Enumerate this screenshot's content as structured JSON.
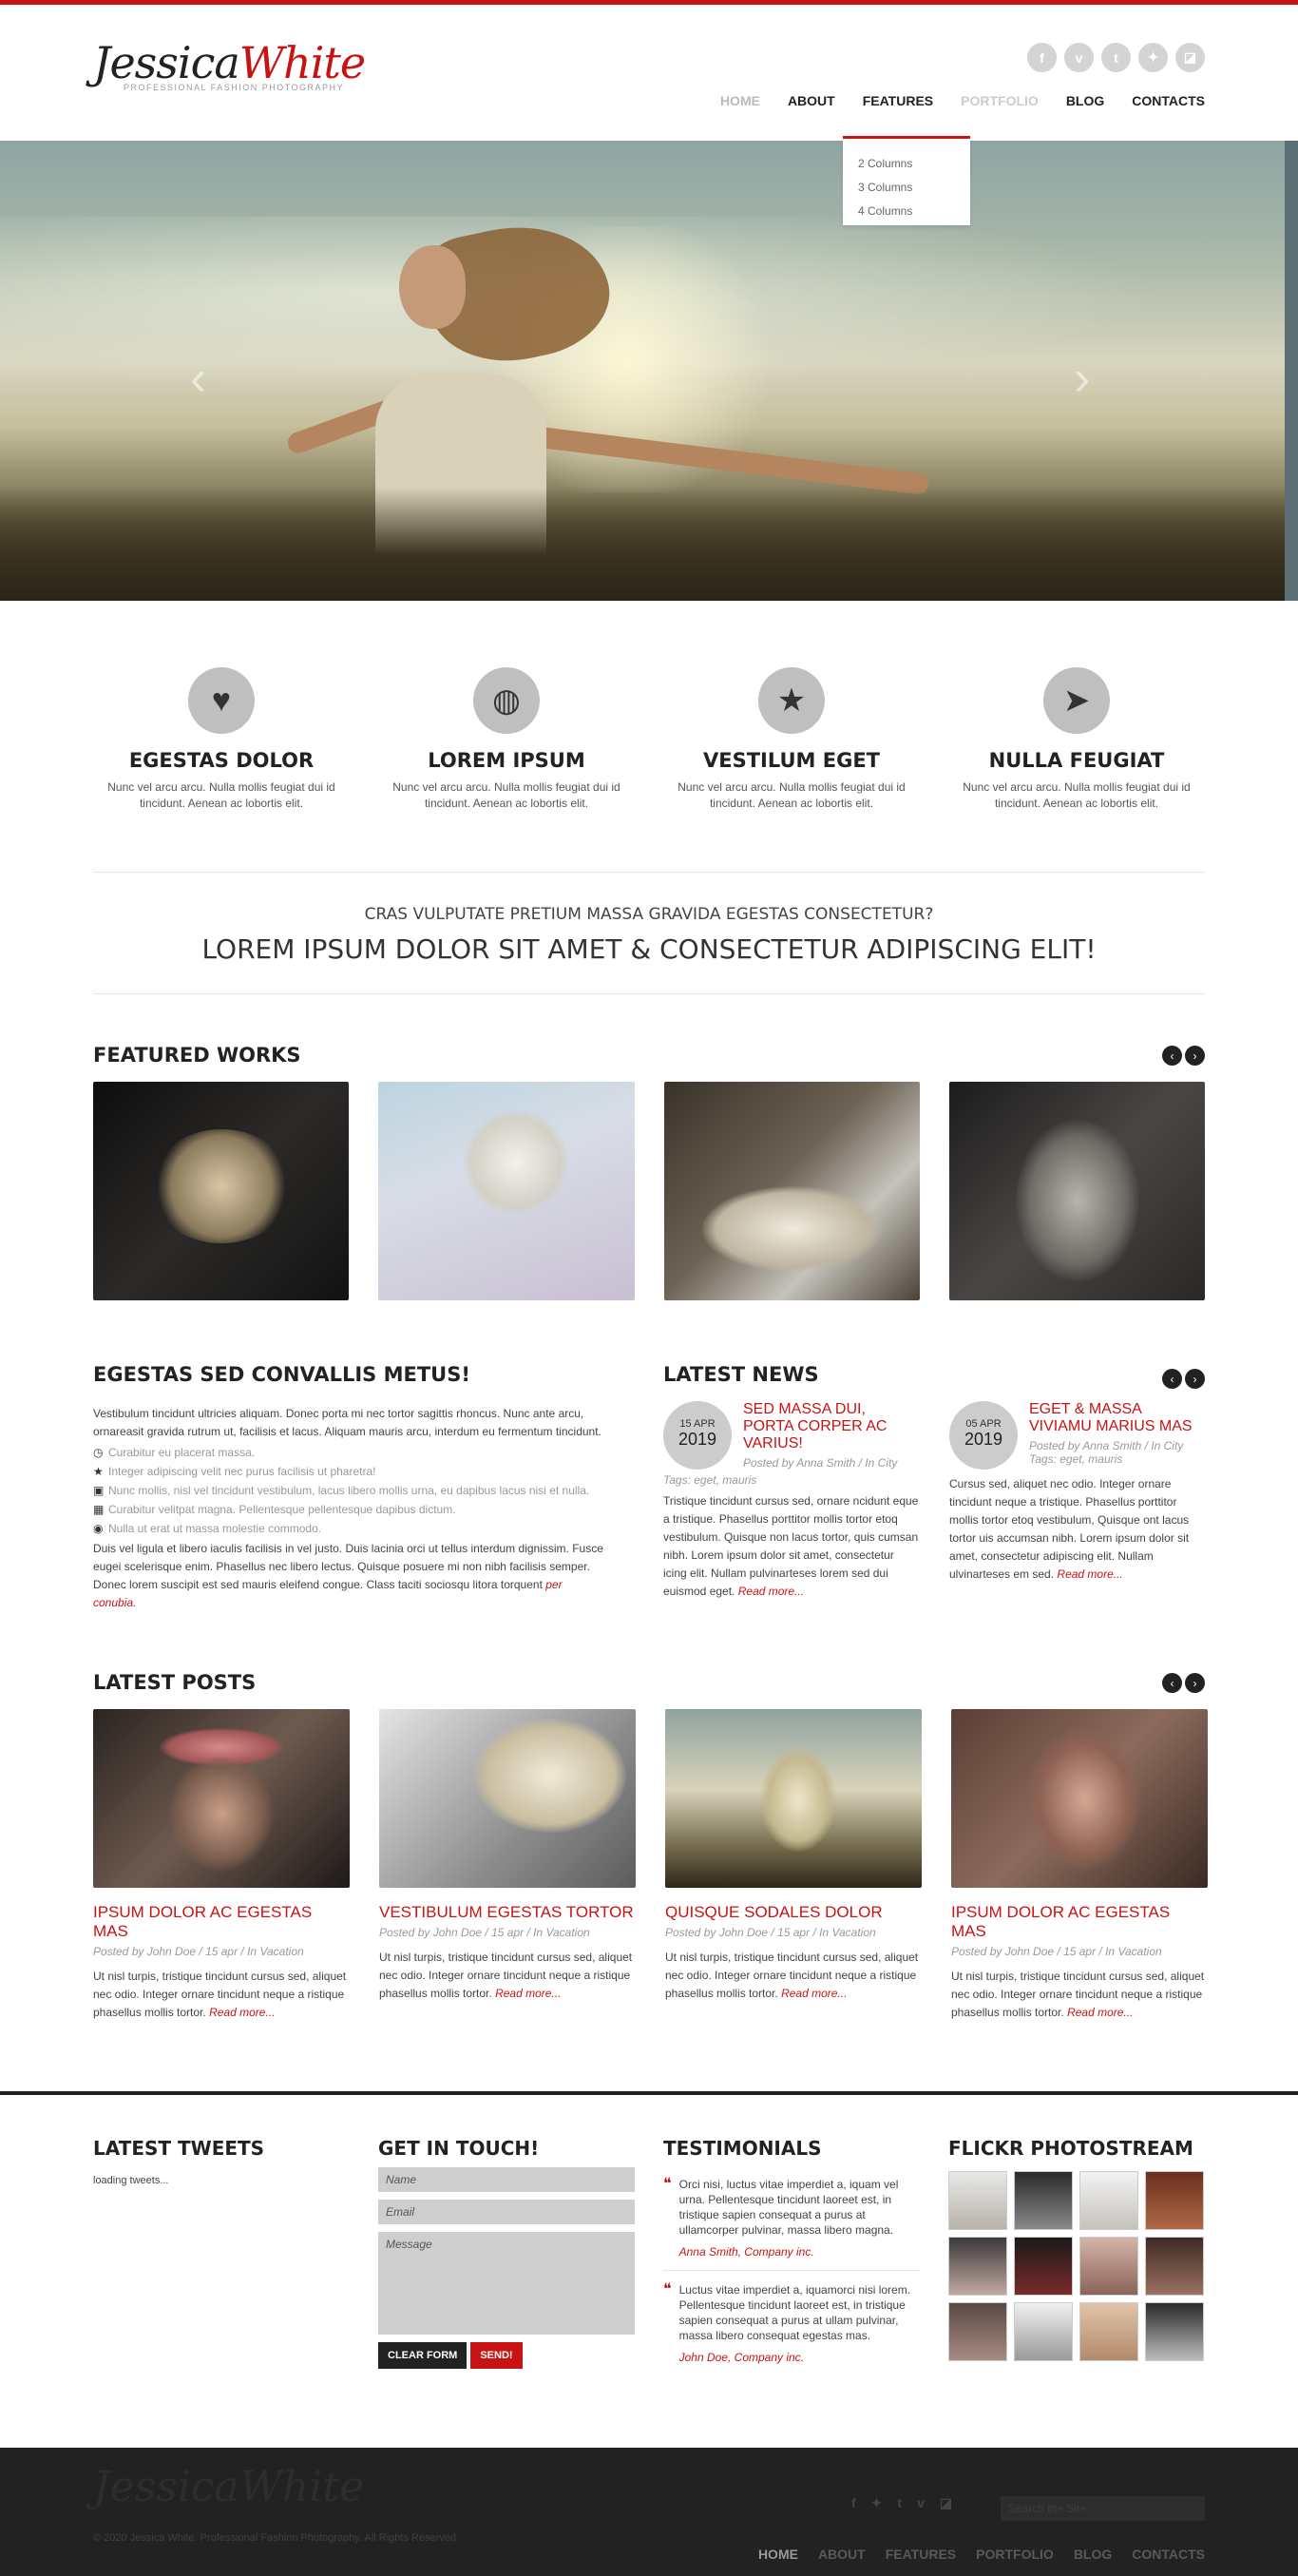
{
  "brand": {
    "name_part1": "Jessica",
    "name_part2": "White",
    "tagline": "PROFESSIONAL FASHION PHOTOGRAPHY"
  },
  "social": [
    {
      "icon": "facebook-icon",
      "glyph": "f"
    },
    {
      "icon": "vimeo-icon",
      "glyph": "v"
    },
    {
      "icon": "tumblr-icon",
      "glyph": "t"
    },
    {
      "icon": "twitter-icon",
      "glyph": "✦"
    },
    {
      "icon": "delicious-icon",
      "glyph": "◪"
    }
  ],
  "nav": [
    "HOME",
    "ABOUT",
    "FEATURES",
    "PORTFOLIO",
    "BLOG",
    "CONTACTS"
  ],
  "dropdown": [
    "2 Columns",
    "3 Columns",
    "4 Columns"
  ],
  "features": [
    {
      "icon": "heart-icon",
      "glyph": "♥",
      "title": "EGESTAS DOLOR",
      "text": "Nunc vel arcu arcu. Nulla mollis feugiat dui id tincidunt. Aenean ac lobortis elit."
    },
    {
      "icon": "globe-icon",
      "glyph": "◍",
      "title": "LOREM IPSUM",
      "text": "Nunc vel arcu arcu. Nulla mollis feugiat dui id tincidunt. Aenean ac lobortis elit."
    },
    {
      "icon": "star-icon",
      "glyph": "★",
      "title": "VESTILUM EGET",
      "text": "Nunc vel arcu arcu. Nulla mollis feugiat dui id tincidunt. Aenean ac lobortis elit."
    },
    {
      "icon": "send-icon",
      "glyph": "➤",
      "title": "NULLA FEUGIAT",
      "text": "Nunc vel arcu arcu. Nulla mollis feugiat dui id tincidunt. Aenean ac lobortis elit."
    }
  ],
  "tagline": {
    "sub": "CRAS VULPUTATE PRETIUM MASSA GRAVIDA EGESTAS CONSECTETUR?",
    "main": "LOREM IPSUM DOLOR SIT AMET & CONSECTETUR ADIPISCING ELIT!"
  },
  "featured": {
    "title": "FEATURED WORKS"
  },
  "about": {
    "title": "EGESTAS SED CONVALLIS METUS!",
    "intro": "Vestibulum tincidunt ultricies aliquam. Donec porta mi nec tortor sagittis rhoncus. Nunc ante arcu, ornareasit gravida rutrum ut, facilisis et lacus. Aliquam mauris arcu, interdum eu fermentum tincidunt.",
    "list": [
      {
        "icon": "clock-icon",
        "glyph": "◷",
        "text": "Curabitur eu placerat massa."
      },
      {
        "icon": "star-icon",
        "glyph": "★",
        "text": "Integer adipiscing velit nec purus facilisis ut pharetra!"
      },
      {
        "icon": "camera-icon",
        "glyph": "▣",
        "text": "Nunc mollis, nisl vel tincidunt vestibulum, lacus libero mollis urna, eu dapibus lacus nisi et nulla."
      },
      {
        "icon": "grid-icon",
        "glyph": "▦",
        "text": "Curabitur velitpat magna. Pellentesque pellentesque dapibus dictum."
      },
      {
        "icon": "user-icon",
        "glyph": "◉",
        "text": "Nulla ut erat ut massa molestie commodo."
      }
    ],
    "outro": "Duis vel ligula et libero iaculis facilisis in vel justo. Duis lacinia orci ut tellus interdum dignissim. Fusce eugei scelerisque enim. Phasellus nec libero lectus. Quisque posuere mi non nibh facilisis semper. Donec lorem suscipit est sed mauris eleifend congue. Class taciti sociosqu litora torquent",
    "outro_link": "per conubia."
  },
  "news": {
    "title": "LATEST NEWS",
    "items": [
      {
        "day": "15 APR",
        "year": "2019",
        "title": "SED MASSA DUI, PORTA CORPER AC VARIUS!",
        "meta": "Posted by Anna Smith / In City",
        "tags": "Tags: eget, mauris",
        "text": "Tristique tincidunt cursus sed, ornare ncidunt eque a tristique. Phasellus porttitor mollis tortor etoq vestibulum. Quisque non lacus tortor, quis cumsan nibh. Lorem ipsum dolor sit amet, consectetur icing elit. Nullam pulvinarteses lorem sed dui euismod eget.",
        "more": "Read more..."
      },
      {
        "day": "05 APR",
        "year": "2019",
        "title": "EGET & MASSA VIVIAMU MARIUS MAS",
        "meta": "Posted by Anna Smith / In City",
        "tags": "Tags: eget, mauris",
        "text": "Cursus sed, aliquet nec odio. Integer ornare tincidunt neque a tristique. Phasellus porttitor mollis tortor etoq vestibulum, Quisque ont lacus tortor uis accumsan nibh. Lorem ipsum dolor sit amet, consectetur adipiscing elit. Nullam ulvinarteses em sed.",
        "more": "Read more..."
      }
    ]
  },
  "posts": {
    "title": "LATEST POSTS",
    "items": [
      {
        "title": "IPSUM DOLOR AC EGESTAS MAS",
        "meta": "Posted by John Doe / 15 apr / In Vacation",
        "text": "Ut nisl turpis, tristique tincidunt cursus sed, aliquet nec odio. Integer ornare tincidunt neque a ristique phasellus mollis tortor.",
        "more": "Read more..."
      },
      {
        "title": "VESTIBULUM EGESTAS TORTOR",
        "meta": "Posted by John Doe / 15 apr / In Vacation",
        "text": "Ut nisl turpis, tristique tincidunt cursus sed, aliquet nec odio. Integer ornare tincidunt neque a ristique phasellus mollis tortor.",
        "more": "Read more..."
      },
      {
        "title": "QUISQUE SODALES DOLOR",
        "meta": "Posted by John Doe / 15 apr / In Vacation",
        "text": "Ut nisl turpis, tristique tincidunt cursus sed, aliquet nec odio. Integer ornare tincidunt neque a ristique phasellus mollis tortor.",
        "more": "Read more..."
      },
      {
        "title": "IPSUM DOLOR AC EGESTAS MAS",
        "meta": "Posted by John Doe / 15 apr / In Vacation",
        "text": "Ut nisl turpis, tristique tincidunt cursus sed, aliquet nec odio. Integer ornare tincidunt neque a ristique phasellus mollis tortor.",
        "more": "Read more..."
      }
    ]
  },
  "widgets": {
    "tweets": {
      "title": "LATEST TWEETS",
      "loading": "loading tweets..."
    },
    "contact": {
      "title": "GET IN TOUCH!",
      "name_placeholder": "Name",
      "email_placeholder": "Email",
      "message_placeholder": "Message",
      "clear_label": "CLEAR FORM",
      "send_label": "SEND!"
    },
    "testimonials": {
      "title": "TESTIMONIALS",
      "items": [
        {
          "text": "Orci nisi, luctus vitae imperdiet a, iquam vel urna. Pellentesque tincidunt laoreet est, in tristique sapien consequat a purus at ullamcorper pulvinar, massa libero magna.",
          "author": "Anna Smith, Company inc."
        },
        {
          "text": "Luctus vitae imperdiet a, iquamorci nisi lorem. Pellentesque tincidunt laoreet est, in tristique sapien consequat a purus at ullam pulvinar, massa libero consequat egestas mas.",
          "author": "John Doe, Company inc."
        }
      ]
    },
    "flickr": {
      "title": "FLICKR PHOTOSTREAM"
    }
  },
  "footer": {
    "logo": "JessicaWhite",
    "copyright": "© 2020 Jessica White. Professional Fashion Photography. All Rights Reserved",
    "search_placeholder": "Search the Site",
    "social": [
      "f",
      "✦",
      "t",
      "v",
      "◪"
    ],
    "nav": [
      "HOME",
      "ABOUT",
      "FEATURES",
      "PORTFOLIO",
      "BLOG",
      "CONTACTS"
    ]
  },
  "colors": {
    "accent": "#c81313",
    "dark": "#222222",
    "footer_bg": "#222222"
  }
}
